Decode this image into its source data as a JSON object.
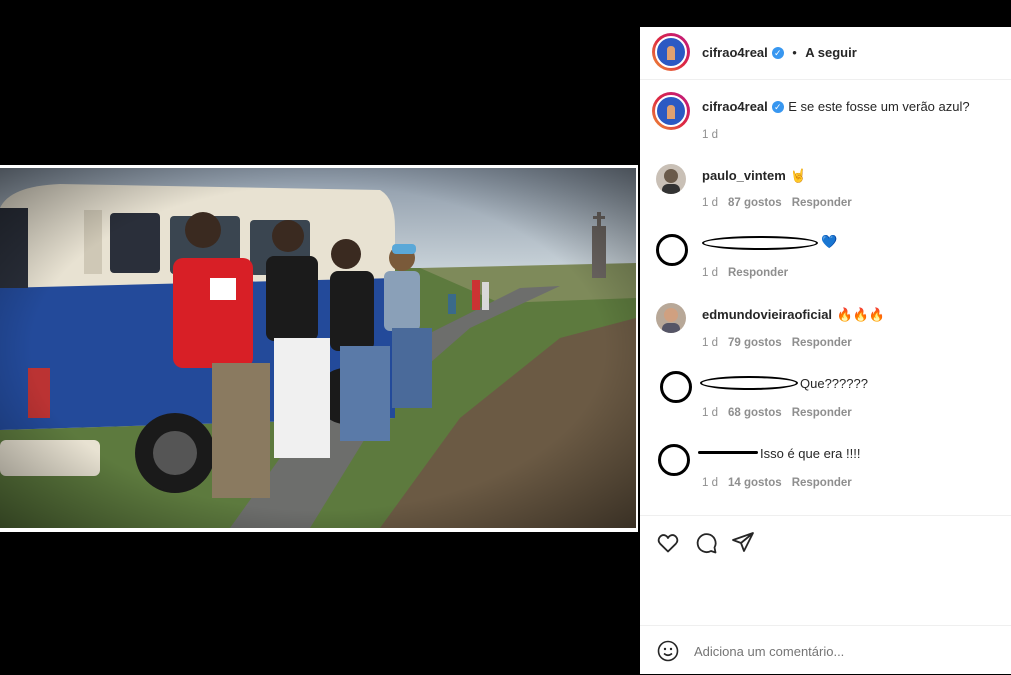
{
  "post": {
    "author": "cifrao4real",
    "follow_label": "A seguir",
    "dot": "•",
    "caption": "E se este fosse um verão azul?",
    "caption_time": "1 d"
  },
  "comments": [
    {
      "user": "paulo_vintem",
      "text": "🤘",
      "time": "1 d",
      "likes": "87 gostos",
      "reply": "Responder"
    },
    {
      "user": "",
      "text": "💙",
      "time": "1 d",
      "likes": "",
      "reply": "Responder"
    },
    {
      "user": "edmundovieiraoficial",
      "text": "🔥🔥🔥",
      "time": "1 d",
      "likes": "79 gostos",
      "reply": "Responder"
    },
    {
      "user": "",
      "text": "Que??????",
      "time": "1 d",
      "likes": "68 gostos",
      "reply": "Responder"
    },
    {
      "user": "",
      "text": "Isso é que era !!!!",
      "time": "1 d",
      "likes": "14 gostos",
      "reply": "Responder"
    }
  ],
  "actions": {
    "like_icon": "heart-icon",
    "comment_icon": "comment-icon",
    "share_icon": "send-icon"
  },
  "add_comment": {
    "placeholder": "Adiciona um comentário...",
    "emoji_icon": "smile-icon"
  },
  "colors": {
    "verified": "#3897f0",
    "meta": "#8e8e8e"
  }
}
